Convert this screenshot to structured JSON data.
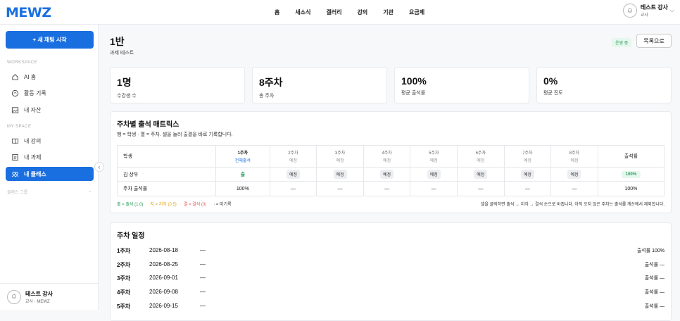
{
  "app": {
    "logo": "MEWZ"
  },
  "nav": [
    "홈",
    "새소식",
    "갤러리",
    "강의",
    "기관",
    "요금제"
  ],
  "user": {
    "name": "테스트 강사",
    "role": "교사",
    "footer_role": "교사 · MEWZ"
  },
  "sidebar": {
    "new_chat": "+ 새 채팅 시작",
    "workspace_label": "WORKSPACE",
    "workspace_items": [
      {
        "label": "AI 홈",
        "icon": "home-icon"
      },
      {
        "label": "활동 기록",
        "icon": "chat-icon"
      },
      {
        "label": "내 자산",
        "icon": "image-icon"
      }
    ],
    "myspace_label": "MY SPACE",
    "myspace_items": [
      {
        "label": "내 강의",
        "icon": "book-icon"
      },
      {
        "label": "내 과제",
        "icon": "doc-icon"
      },
      {
        "label": "내 클래스",
        "icon": "users-icon",
        "active": true
      }
    ],
    "sub_label": "클래스 그룹"
  },
  "page": {
    "title": "1반",
    "subtitle": "과제 테스트",
    "status": "운영 중",
    "back": "목록으로"
  },
  "stats": [
    {
      "value": "1명",
      "label": "수강생 수"
    },
    {
      "value": "8주차",
      "label": "총 주차"
    },
    {
      "value": "100%",
      "label": "평균 출석률"
    },
    {
      "value": "0%",
      "label": "평균 진도"
    }
  ],
  "matrix": {
    "title": "주차별 출석 매트릭스",
    "desc": "행 = 학생 · 열 = 주차. 셀을 눌러 출결을 바로 기록합니다.",
    "col_student": "학생",
    "col_rate": "출석률",
    "weeks": [
      {
        "label": "1주차",
        "sub": "전체출석"
      },
      {
        "label": "2주차",
        "sub": "예정"
      },
      {
        "label": "3주차",
        "sub": "예정"
      },
      {
        "label": "4주차",
        "sub": "예정"
      },
      {
        "label": "5주차",
        "sub": "예정"
      },
      {
        "label": "6주차",
        "sub": "예정"
      },
      {
        "label": "7주차",
        "sub": "예정"
      },
      {
        "label": "8주차",
        "sub": "예정"
      }
    ],
    "student": {
      "name": "김 상우",
      "cells": [
        "출",
        "예정",
        "예정",
        "예정",
        "예정",
        "예정",
        "예정",
        "예정"
      ],
      "rate": "100%"
    },
    "summary": {
      "label": "주차 출석률",
      "cells": [
        "100%",
        "—",
        "—",
        "—",
        "—",
        "—",
        "—",
        "—"
      ],
      "rate": "100%"
    },
    "legend": [
      {
        "text": "출 = 출석 (1.0)",
        "color": "#2a9d5c"
      },
      {
        "text": "지 = 지각 (0.5)",
        "color": "#e0a21a"
      },
      {
        "text": "결 = 결석 (0)",
        "color": "#e05252"
      },
      {
        "text": "· = 미기록",
        "color": "#333333"
      }
    ],
    "note": "셀을 클릭하면 출석 → 지각 → 결석 순으로 바뀝니다. 아직 오지 않은 주차는 출석률 계산에서 제외합니다."
  },
  "schedule": {
    "title": "주차 일정",
    "rows": [
      {
        "week": "1주차",
        "date": "2026-08-18",
        "desc": "—",
        "right": "출석률 100%"
      },
      {
        "week": "2주차",
        "date": "2026-08-25",
        "desc": "—",
        "right": "출석률 —"
      },
      {
        "week": "3주차",
        "date": "2026-09-01",
        "desc": "—",
        "right": "출석률 —"
      },
      {
        "week": "4주차",
        "date": "2026-09-08",
        "desc": "—",
        "right": "출석률 —"
      },
      {
        "week": "5주차",
        "date": "2026-09-15",
        "desc": "—",
        "right": "출석률 —"
      }
    ]
  }
}
